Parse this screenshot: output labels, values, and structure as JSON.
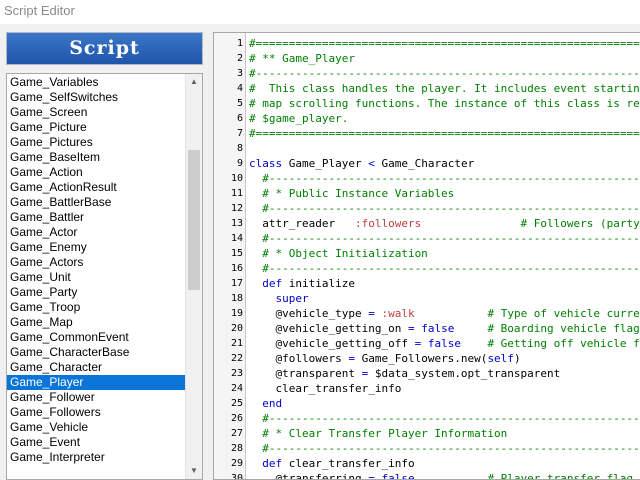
{
  "window": {
    "title": "Script Editor"
  },
  "sidebar": {
    "header": "Script",
    "items": [
      "Game_Variables",
      "Game_SelfSwitches",
      "Game_Screen",
      "Game_Picture",
      "Game_Pictures",
      "Game_BaseItem",
      "Game_Action",
      "Game_ActionResult",
      "Game_BattlerBase",
      "Game_Battler",
      "Game_Actor",
      "Game_Enemy",
      "Game_Actors",
      "Game_Unit",
      "Game_Party",
      "Game_Troop",
      "Game_Map",
      "Game_CommonEvent",
      "Game_CharacterBase",
      "Game_Character",
      "Game_Player",
      "Game_Follower",
      "Game_Followers",
      "Game_Vehicle",
      "Game_Event",
      "Game_Interpreter"
    ],
    "selected_item": "Game_Player"
  },
  "editor": {
    "lines": [
      {
        "n": "1",
        "segs": [
          [
            "c-cmt",
            "#=============================================================================="
          ]
        ]
      },
      {
        "n": "2",
        "segs": [
          [
            "c-cmt",
            "# ** Game_Player"
          ]
        ]
      },
      {
        "n": "3",
        "segs": [
          [
            "c-cmt",
            "#------------------------------------------------------------------------------"
          ]
        ]
      },
      {
        "n": "4",
        "segs": [
          [
            "c-cmt",
            "#  This class handles the player. It includes event starting determinants and"
          ]
        ]
      },
      {
        "n": "5",
        "segs": [
          [
            "c-cmt",
            "# map scrolling functions. The instance of this class is referenced by"
          ]
        ]
      },
      {
        "n": "6",
        "segs": [
          [
            "c-cmt",
            "# $game_player."
          ]
        ]
      },
      {
        "n": "7",
        "segs": [
          [
            "c-cmt",
            "#=============================================================================="
          ]
        ]
      },
      {
        "n": "8",
        "segs": []
      },
      {
        "n": "9",
        "segs": [
          [
            "c-kw",
            "class "
          ],
          [
            "c-txt",
            "Game_Player "
          ],
          [
            "c-kw",
            "< "
          ],
          [
            "c-txt",
            "Game_Character"
          ]
        ]
      },
      {
        "n": "10",
        "segs": [
          [
            "c-cmt",
            "  #--------------------------------------------------------------------------"
          ]
        ]
      },
      {
        "n": "11",
        "segs": [
          [
            "c-cmt",
            "  # * Public Instance Variables"
          ]
        ]
      },
      {
        "n": "12",
        "segs": [
          [
            "c-cmt",
            "  #--------------------------------------------------------------------------"
          ]
        ]
      },
      {
        "n": "13",
        "segs": [
          [
            "c-txt",
            "  attr_reader   "
          ],
          [
            "c-sym",
            ":followers"
          ],
          [
            "c-txt",
            "               "
          ],
          [
            "c-cmt",
            "# Followers (party members)"
          ]
        ]
      },
      {
        "n": "14",
        "segs": [
          [
            "c-cmt",
            "  #--------------------------------------------------------------------------"
          ]
        ]
      },
      {
        "n": "15",
        "segs": [
          [
            "c-cmt",
            "  # * Object Initialization"
          ]
        ]
      },
      {
        "n": "16",
        "segs": [
          [
            "c-cmt",
            "  #--------------------------------------------------------------------------"
          ]
        ]
      },
      {
        "n": "17",
        "segs": [
          [
            "c-kw",
            "  def "
          ],
          [
            "c-txt",
            "initialize"
          ]
        ]
      },
      {
        "n": "18",
        "segs": [
          [
            "c-kw",
            "    super"
          ]
        ]
      },
      {
        "n": "19",
        "segs": [
          [
            "c-txt",
            "    @vehicle_type "
          ],
          [
            "c-kw",
            "= "
          ],
          [
            "c-sym",
            ":walk"
          ],
          [
            "c-txt",
            "           "
          ],
          [
            "c-cmt",
            "# Type of vehicle currently being ridden"
          ]
        ]
      },
      {
        "n": "20",
        "segs": [
          [
            "c-txt",
            "    @vehicle_getting_on "
          ],
          [
            "c-kw",
            "= false"
          ],
          [
            "c-txt",
            "     "
          ],
          [
            "c-cmt",
            "# Boarding vehicle flag"
          ]
        ]
      },
      {
        "n": "21",
        "segs": [
          [
            "c-txt",
            "    @vehicle_getting_off "
          ],
          [
            "c-kw",
            "= false"
          ],
          [
            "c-txt",
            "    "
          ],
          [
            "c-cmt",
            "# Getting off vehicle flag"
          ]
        ]
      },
      {
        "n": "22",
        "segs": [
          [
            "c-txt",
            "    @followers "
          ],
          [
            "c-kw",
            "= "
          ],
          [
            "c-txt",
            "Game_Followers.new("
          ],
          [
            "c-kw",
            "self"
          ],
          [
            "c-txt",
            ")"
          ]
        ]
      },
      {
        "n": "23",
        "segs": [
          [
            "c-txt",
            "    @transparent "
          ],
          [
            "c-kw",
            "= "
          ],
          [
            "c-txt",
            "$data_system.opt_transparent"
          ]
        ]
      },
      {
        "n": "24",
        "segs": [
          [
            "c-txt",
            "    clear_transfer_info"
          ]
        ]
      },
      {
        "n": "25",
        "segs": [
          [
            "c-kw",
            "  end"
          ]
        ]
      },
      {
        "n": "26",
        "segs": [
          [
            "c-cmt",
            "  #--------------------------------------------------------------------------"
          ]
        ]
      },
      {
        "n": "27",
        "segs": [
          [
            "c-cmt",
            "  # * Clear Transfer Player Information"
          ]
        ]
      },
      {
        "n": "28",
        "segs": [
          [
            "c-cmt",
            "  #--------------------------------------------------------------------------"
          ]
        ]
      },
      {
        "n": "29",
        "segs": [
          [
            "c-kw",
            "  def "
          ],
          [
            "c-txt",
            "clear_transfer_info"
          ]
        ]
      },
      {
        "n": "30",
        "segs": [
          [
            "c-txt",
            "    @transferring "
          ],
          [
            "c-kw",
            "= false"
          ],
          [
            "c-txt",
            "           "
          ],
          [
            "c-cmt",
            "# Player transfer flag"
          ]
        ]
      }
    ]
  }
}
